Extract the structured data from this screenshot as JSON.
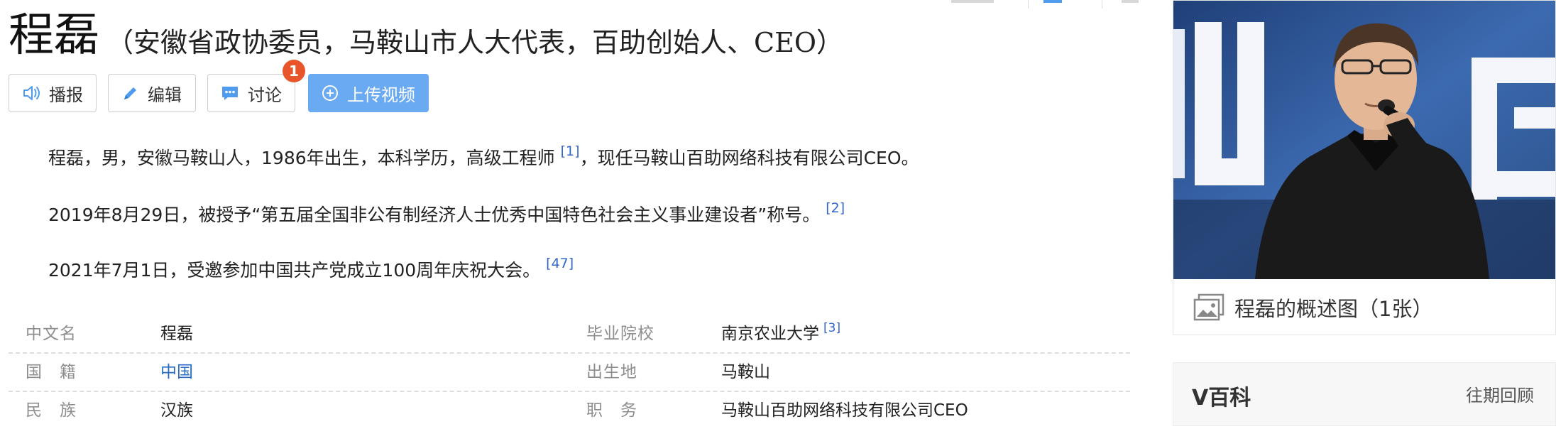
{
  "header": {
    "title": "程磊",
    "subtitle": "（安徽省政协委员，马鞍山市人大代表，百助创始人、CEO）"
  },
  "toolbar": {
    "play": "播报",
    "edit": "编辑",
    "discuss": "讨论",
    "discuss_badge": "1",
    "upload": "上传视频"
  },
  "summary": [
    {
      "text": "程磊，男，安徽马鞍山人，1986年出生，本科学历，高级工程师",
      "ref": "[1]",
      "tail": "，现任马鞍山百助网络科技有限公司CEO。"
    },
    {
      "text": "2019年8月29日，被授予“第五届全国非公有制经济人士优秀中国特色社会主义事业建设者”称号。",
      "ref": "[2]"
    },
    {
      "text": "2021年7月1日，受邀参加中国共产党成立100周年庆祝大会。",
      "ref": "[47]"
    }
  ],
  "infobox": [
    {
      "k1": "中文名",
      "v1": "程磊",
      "k2": "毕业院校",
      "v2": "南京农业大学",
      "ref2": "[3]"
    },
    {
      "k1": "国　籍",
      "v1": "中国",
      "k2": "出生地",
      "v2": "马鞍山"
    },
    {
      "k1": "民　族",
      "v1": "汉族",
      "k2": "职　务",
      "v2": "马鞍山百助网络科技有限公司CEO"
    }
  ],
  "album": {
    "caption": "程磊的概述图（1张）"
  },
  "vbaike": {
    "title": "V百科",
    "more": "往期回顾"
  },
  "colors": {
    "accent": "#6aaaf2",
    "link": "#2a6bc4",
    "badge": "#e8552b"
  },
  "icons": [
    "speaker-icon",
    "pencil-icon",
    "chat-icon",
    "plus-circle-icon",
    "image-icon"
  ]
}
